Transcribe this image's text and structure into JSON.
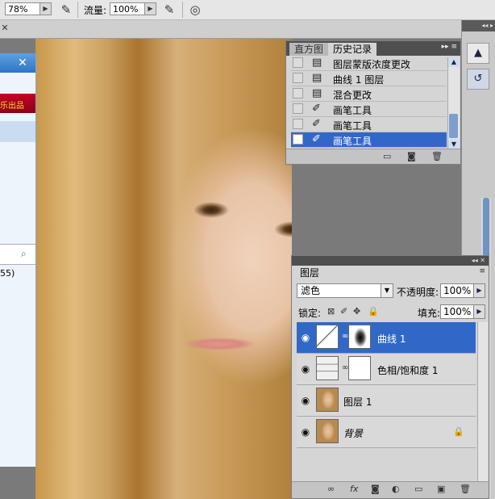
{
  "options_bar": {
    "opacity_value": "78%",
    "flow_label": "流量:",
    "flow_value": "100%"
  },
  "left_window": {
    "banner_text": "乐出品",
    "fragment_text": "55)"
  },
  "history_panel": {
    "tabs": [
      {
        "label": "直方图",
        "active": false
      },
      {
        "label": "历史记录",
        "active": true
      }
    ],
    "rows": [
      {
        "icon": "document-icon",
        "label": "图层蒙版浓度更改",
        "selected": false
      },
      {
        "icon": "document-icon",
        "label": "曲线 1 图层",
        "selected": false
      },
      {
        "icon": "document-icon",
        "label": "混合更改",
        "selected": false
      },
      {
        "icon": "brush-icon",
        "label": "画笔工具",
        "selected": false
      },
      {
        "icon": "brush-icon",
        "label": "画笔工具",
        "selected": false
      },
      {
        "icon": "brush-icon",
        "label": "画笔工具",
        "selected": true
      }
    ]
  },
  "layers_panel": {
    "tab_label": "图层",
    "blend_mode": "滤色",
    "opacity_label": "不透明度:",
    "opacity_value": "100%",
    "lock_label": "锁定:",
    "fill_label": "填充:",
    "fill_value": "100%",
    "layers": [
      {
        "name": "曲线 1",
        "type": "curves",
        "selected": true
      },
      {
        "name": "色相/饱和度 1",
        "type": "hue-saturation",
        "selected": false
      },
      {
        "name": "图层 1",
        "type": "photo",
        "selected": false
      },
      {
        "name": "背景",
        "type": "background",
        "selected": false,
        "locked": true
      }
    ]
  },
  "colors": {
    "selection": "#3168c8",
    "panel_bg": "#d5d5d5",
    "panel_title": "#4f4f4f"
  }
}
